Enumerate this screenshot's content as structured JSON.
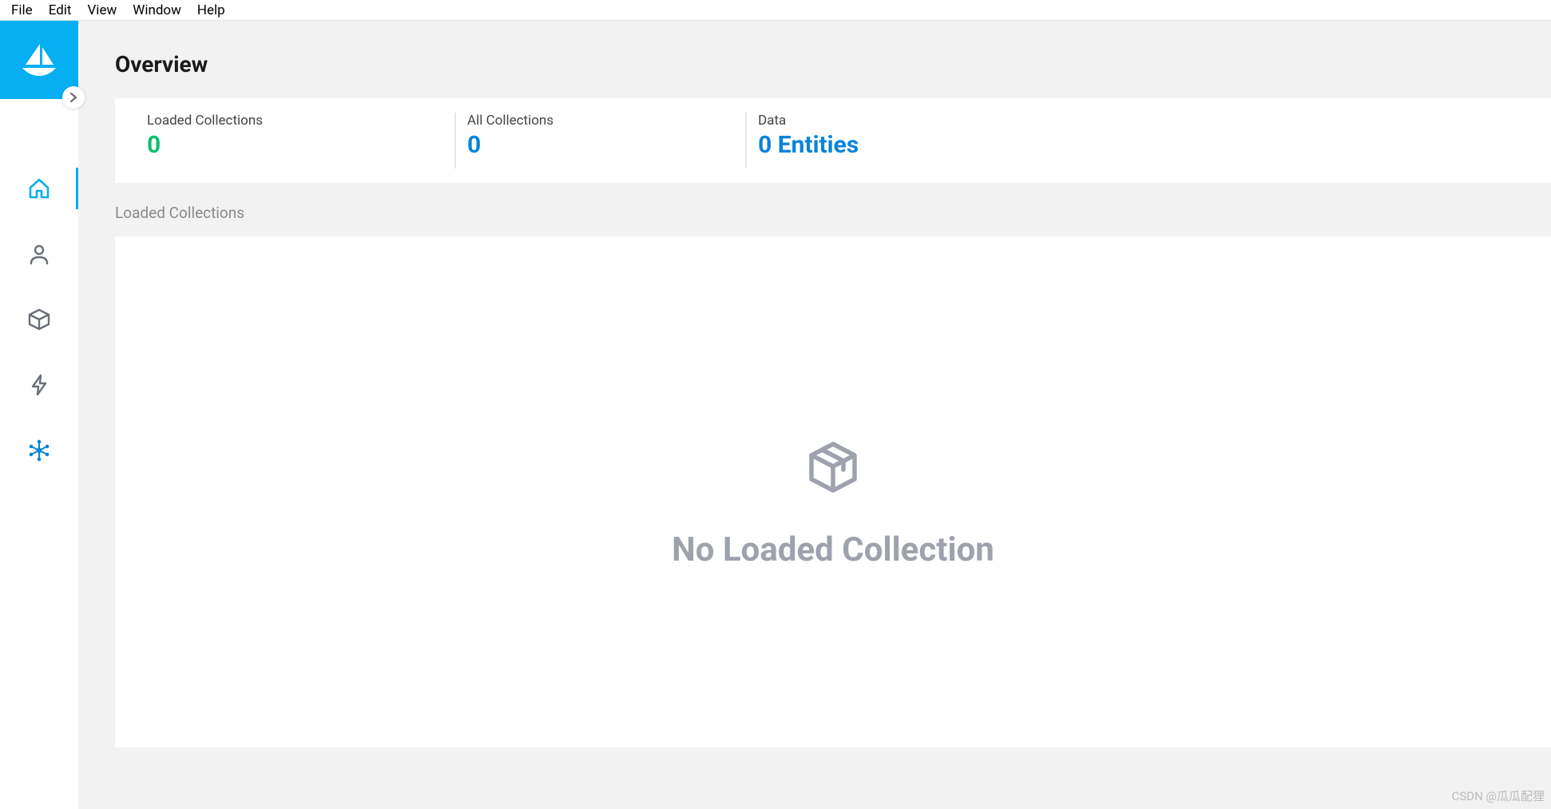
{
  "menu": {
    "items": [
      "File",
      "Edit",
      "View",
      "Window",
      "Help"
    ]
  },
  "page": {
    "title": "Overview"
  },
  "stats": {
    "loaded": {
      "label": "Loaded Collections",
      "value": "0"
    },
    "all": {
      "label": "All Collections",
      "value": "0"
    },
    "data": {
      "label": "Data",
      "value": "0 Entities"
    }
  },
  "section": {
    "label": "Loaded Collections"
  },
  "empty": {
    "message": "No Loaded Collection"
  },
  "watermark": "CSDN @瓜瓜配狸"
}
